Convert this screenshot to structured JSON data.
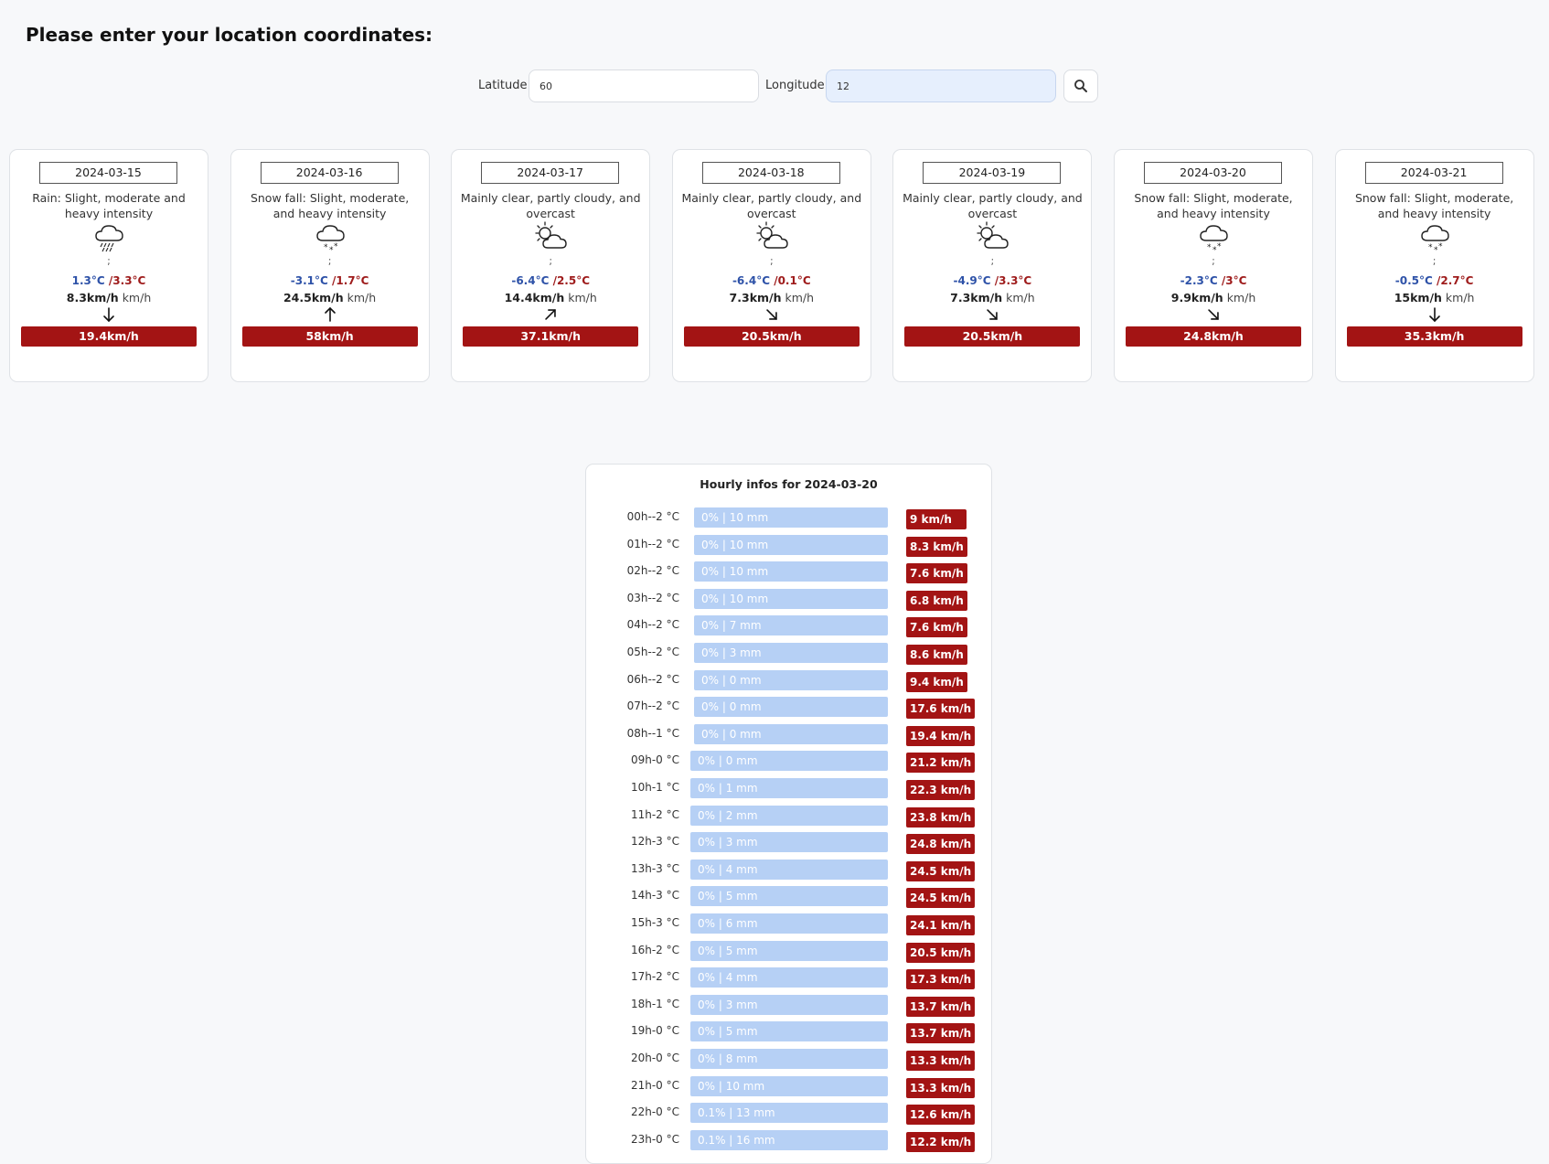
{
  "heading": "Please enter your location coordinates:",
  "form": {
    "latitude_label": "Latitude :",
    "latitude_value": "60",
    "longitude_label": "Longitude :",
    "longitude_value": "12",
    "search_icon": "search-icon"
  },
  "days": [
    {
      "date": "2024-03-15",
      "desc": "Rain: Slight, moderate and heavy intensity",
      "icon": "rain-icon",
      "sep": ";",
      "tmin": "1.3°C",
      "tmax": "/3.3°C",
      "wind": "8.3km/h",
      "wind_unit": "km/h",
      "direction": "arrow-down",
      "gust": "19.4km/h"
    },
    {
      "date": "2024-03-16",
      "desc": "Snow fall: Slight, moderate, and heavy intensity",
      "icon": "snow-icon",
      "sep": ";",
      "tmin": "-3.1°C",
      "tmax": "/1.7°C",
      "wind": "24.5km/h",
      "wind_unit": "km/h",
      "direction": "arrow-up",
      "gust": "58km/h"
    },
    {
      "date": "2024-03-17",
      "desc": "Mainly clear, partly cloudy, and overcast",
      "icon": "partly-cloudy-icon",
      "sep": ";",
      "tmin": "-6.4°C",
      "tmax": "/2.5°C",
      "wind": "14.4km/h",
      "wind_unit": "km/h",
      "direction": "arrow-up-right",
      "gust": "37.1km/h"
    },
    {
      "date": "2024-03-18",
      "desc": "Mainly clear, partly cloudy, and overcast",
      "icon": "partly-cloudy-icon",
      "sep": ";",
      "tmin": "-6.4°C",
      "tmax": "/0.1°C",
      "wind": "7.3km/h",
      "wind_unit": "km/h",
      "direction": "arrow-down-right",
      "gust": "20.5km/h"
    },
    {
      "date": "2024-03-19",
      "desc": "Mainly clear, partly cloudy, and overcast",
      "icon": "partly-cloudy-icon",
      "sep": ";",
      "tmin": "-4.9°C",
      "tmax": "/3.3°C",
      "wind": "7.3km/h",
      "wind_unit": "km/h",
      "direction": "arrow-down-right",
      "gust": "20.5km/h"
    },
    {
      "date": "2024-03-20",
      "desc": "Snow fall: Slight, moderate, and heavy intensity",
      "icon": "snow-icon",
      "sep": ";",
      "tmin": "-2.3°C",
      "tmax": "/3°C",
      "wind": "9.9km/h",
      "wind_unit": "km/h",
      "direction": "arrow-down-right",
      "gust": "24.8km/h"
    },
    {
      "date": "2024-03-21",
      "desc": "Snow fall: Slight, moderate, and heavy intensity",
      "icon": "snow-icon",
      "sep": ";",
      "tmin": "-0.5°C",
      "tmax": "/2.7°C",
      "wind": "15km/h",
      "wind_unit": "km/h",
      "direction": "arrow-down",
      "gust": "35.3km/h"
    }
  ],
  "hourly": {
    "title": "Hourly infos for 2024-03-20",
    "rows": [
      {
        "label": "00h--2 °C",
        "precip": "0% | 10 mm",
        "wind": "9 km/h"
      },
      {
        "label": "01h--2 °C",
        "precip": "0% | 10 mm",
        "wind": "8.3 km/h"
      },
      {
        "label": "02h--2 °C",
        "precip": "0% | 10 mm",
        "wind": "7.6 km/h"
      },
      {
        "label": "03h--2 °C",
        "precip": "0% | 10 mm",
        "wind": "6.8 km/h"
      },
      {
        "label": "04h--2 °C",
        "precip": "0% | 7 mm",
        "wind": "7.6 km/h"
      },
      {
        "label": "05h--2 °C",
        "precip": "0% | 3 mm",
        "wind": "8.6 km/h"
      },
      {
        "label": "06h--2 °C",
        "precip": "0% | 0 mm",
        "wind": "9.4 km/h"
      },
      {
        "label": "07h--2 °C",
        "precip": "0% | 0 mm",
        "wind": "17.6 km/h"
      },
      {
        "label": "08h--1 °C",
        "precip": "0% | 0 mm",
        "wind": "19.4 km/h"
      },
      {
        "label": "09h-0 °C",
        "precip": "0% | 0 mm",
        "wind": "21.2 km/h"
      },
      {
        "label": "10h-1 °C",
        "precip": "0% | 1 mm",
        "wind": "22.3 km/h"
      },
      {
        "label": "11h-2 °C",
        "precip": "0% | 2 mm",
        "wind": "23.8 km/h"
      },
      {
        "label": "12h-3 °C",
        "precip": "0% | 3 mm",
        "wind": "24.8 km/h"
      },
      {
        "label": "13h-3 °C",
        "precip": "0% | 4 mm",
        "wind": "24.5 km/h"
      },
      {
        "label": "14h-3 °C",
        "precip": "0% | 5 mm",
        "wind": "24.5 km/h"
      },
      {
        "label": "15h-3 °C",
        "precip": "0% | 6 mm",
        "wind": "24.1 km/h"
      },
      {
        "label": "16h-2 °C",
        "precip": "0% | 5 mm",
        "wind": "20.5 km/h"
      },
      {
        "label": "17h-2 °C",
        "precip": "0% | 4 mm",
        "wind": "17.3 km/h"
      },
      {
        "label": "18h-1 °C",
        "precip": "0% | 3 mm",
        "wind": "13.7 km/h"
      },
      {
        "label": "19h-0 °C",
        "precip": "0% | 5 mm",
        "wind": "13.7 km/h"
      },
      {
        "label": "20h-0 °C",
        "precip": "0% | 8 mm",
        "wind": "13.3 km/h"
      },
      {
        "label": "21h-0 °C",
        "precip": "0% | 10 mm",
        "wind": "13.3 km/h"
      },
      {
        "label": "22h-0 °C",
        "precip": "0.1% | 13 mm",
        "wind": "12.6 km/h"
      },
      {
        "label": "23h-0 °C",
        "precip": "0.1% | 16 mm",
        "wind": "12.2 km/h"
      }
    ]
  },
  "colors": {
    "background": "#f7f8fa",
    "gust_badge": "#a31414",
    "precip_bar": "#b6d0f5",
    "temp_min": "#2e52a8",
    "temp_max": "#9e1b1b",
    "focused_input": "#e6effd"
  }
}
